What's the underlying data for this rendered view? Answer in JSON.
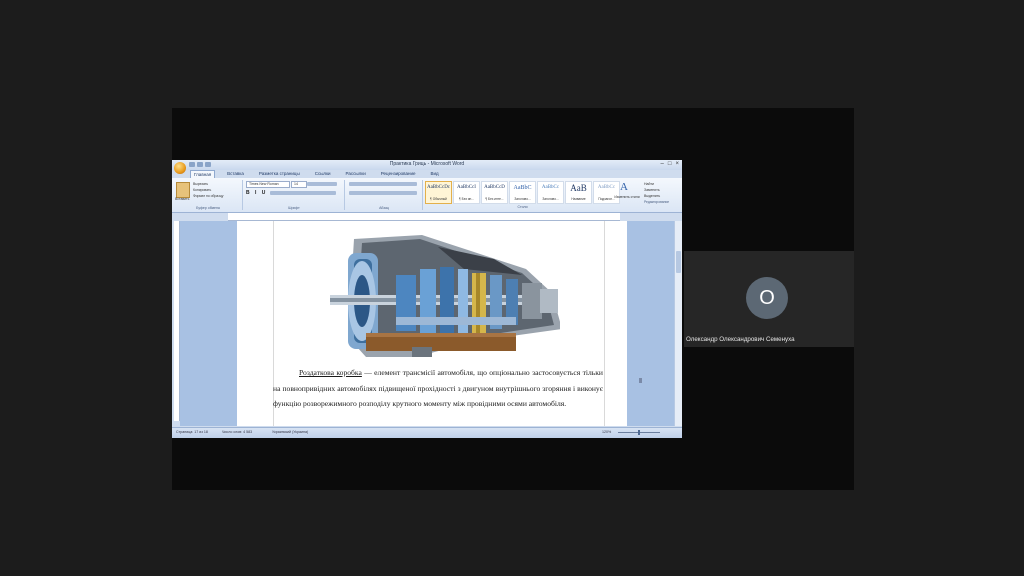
{
  "app": {
    "title": "Практика Гриць - Microsoft Word",
    "tabs": [
      "Главная",
      "Вставка",
      "Разметка страницы",
      "Ссылки",
      "Рассылки",
      "Рецензирование",
      "Вид"
    ],
    "active_tab": "Главная",
    "font_name": "Times New Roman",
    "font_size": "14",
    "clipboard": {
      "paste": "Вставить",
      "cut": "Вырезать",
      "copy": "Копировать",
      "format_painter": "Формат по образцу",
      "label": "Буфер обмена"
    },
    "group_labels": {
      "font": "Шрифт",
      "paragraph": "Абзац",
      "styles": "Стили",
      "editing": "Редактирование"
    },
    "styles": [
      {
        "sample": "AaBbCcDc",
        "name": "¶ Обычный"
      },
      {
        "sample": "AaBbCcI",
        "name": "¶ Без ин..."
      },
      {
        "sample": "AaBbCcD",
        "name": "¶ Без инте..."
      },
      {
        "sample": "AaBbC",
        "name": "Заголово..."
      },
      {
        "sample": "AaBbCc",
        "name": "Заголово..."
      },
      {
        "sample": "AaB",
        "name": "Название"
      },
      {
        "sample": "AaBbCc",
        "name": "Подзагол..."
      }
    ],
    "change_styles": "Изменить стили",
    "editing_items": [
      "Найти",
      "Заменить",
      "Выделить"
    ],
    "status": {
      "page": "Страница: 17 из 18",
      "words": "Число слов: 4 583",
      "lang": "Украинский (Украина)",
      "zoom": "120%"
    }
  },
  "document": {
    "paragraph": [
      {
        "text": "Роздаткова коробка",
        "underline": true
      },
      {
        "text": " — елемент трансмісії автомобіля, що опціонально застосовується тільки на повнопривідних автомобілях підвищеної прохідності з двигуном внутрішнього згоряння і виконує функцію розворежимного розподілу крутного моменту між провідними осями автомобіля.",
        "underline": false
      }
    ],
    "figure": "transfer-case-cutaway"
  },
  "participant": {
    "initial": "О",
    "name": "Олександр Олександрович Семенуха"
  },
  "colors": {
    "background": "#1c1c1c",
    "ribbon": "#dbe6f5",
    "doc_background": "#a8c1e3",
    "avatar": "#5c6874",
    "office_orange": "#e89a1c"
  }
}
